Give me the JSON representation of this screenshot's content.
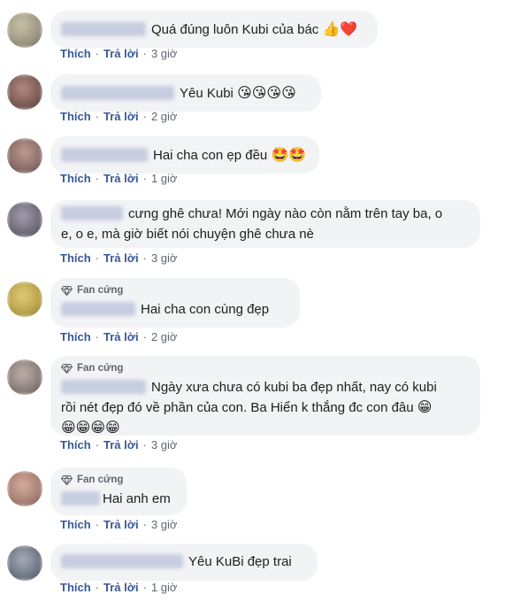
{
  "actions": {
    "like": "Thích",
    "reply": "Trả lời",
    "separator": "·"
  },
  "badge_label": "Fan cứng",
  "comments": [
    {
      "text": "Quá đúng luôn Kubi của bác",
      "emoji": "👍❤️",
      "time": "3 giờ",
      "avatar_color": "#9a9580"
    },
    {
      "text": "Yêu Kubi",
      "emoji": "😘😘😘😘",
      "time": "2 giờ",
      "avatar_color": "#7a5a55"
    },
    {
      "text": "Hai cha con ẹp đều",
      "emoji": "🤩🤩",
      "time": "1 giờ",
      "avatar_color": "#8a6e6a"
    },
    {
      "text_line1": "cưng ghê chưa! Mới ngày nào còn nằm trên tay ba, o",
      "text_line2": "e, o e, mà giờ biết nói chuyện ghê chưa nè",
      "time": "3 giờ",
      "avatar_color": "#6f6a78"
    },
    {
      "text": "Hai cha con cùng đẹp",
      "time": "2 giờ",
      "avatar_color": "#b8a24a"
    },
    {
      "text_line1": "Ngày xưa chưa có kubi ba đẹp nhất, nay có kubi",
      "text_line2": "rồi nét đẹp đó về phần của con. Ba Hiển k thắng đc con đâu",
      "emoji_end": "😁",
      "emoji_line3": "😁😁😁😁",
      "time": "3 giờ",
      "avatar_color": "#8a7d78"
    },
    {
      "text": "Hai anh em",
      "time": "3 giờ",
      "avatar_color": "#a77f73"
    },
    {
      "text": "Yêu KuBi đẹp trai",
      "time": "1 giờ",
      "avatar_color": "#6d7482"
    }
  ]
}
